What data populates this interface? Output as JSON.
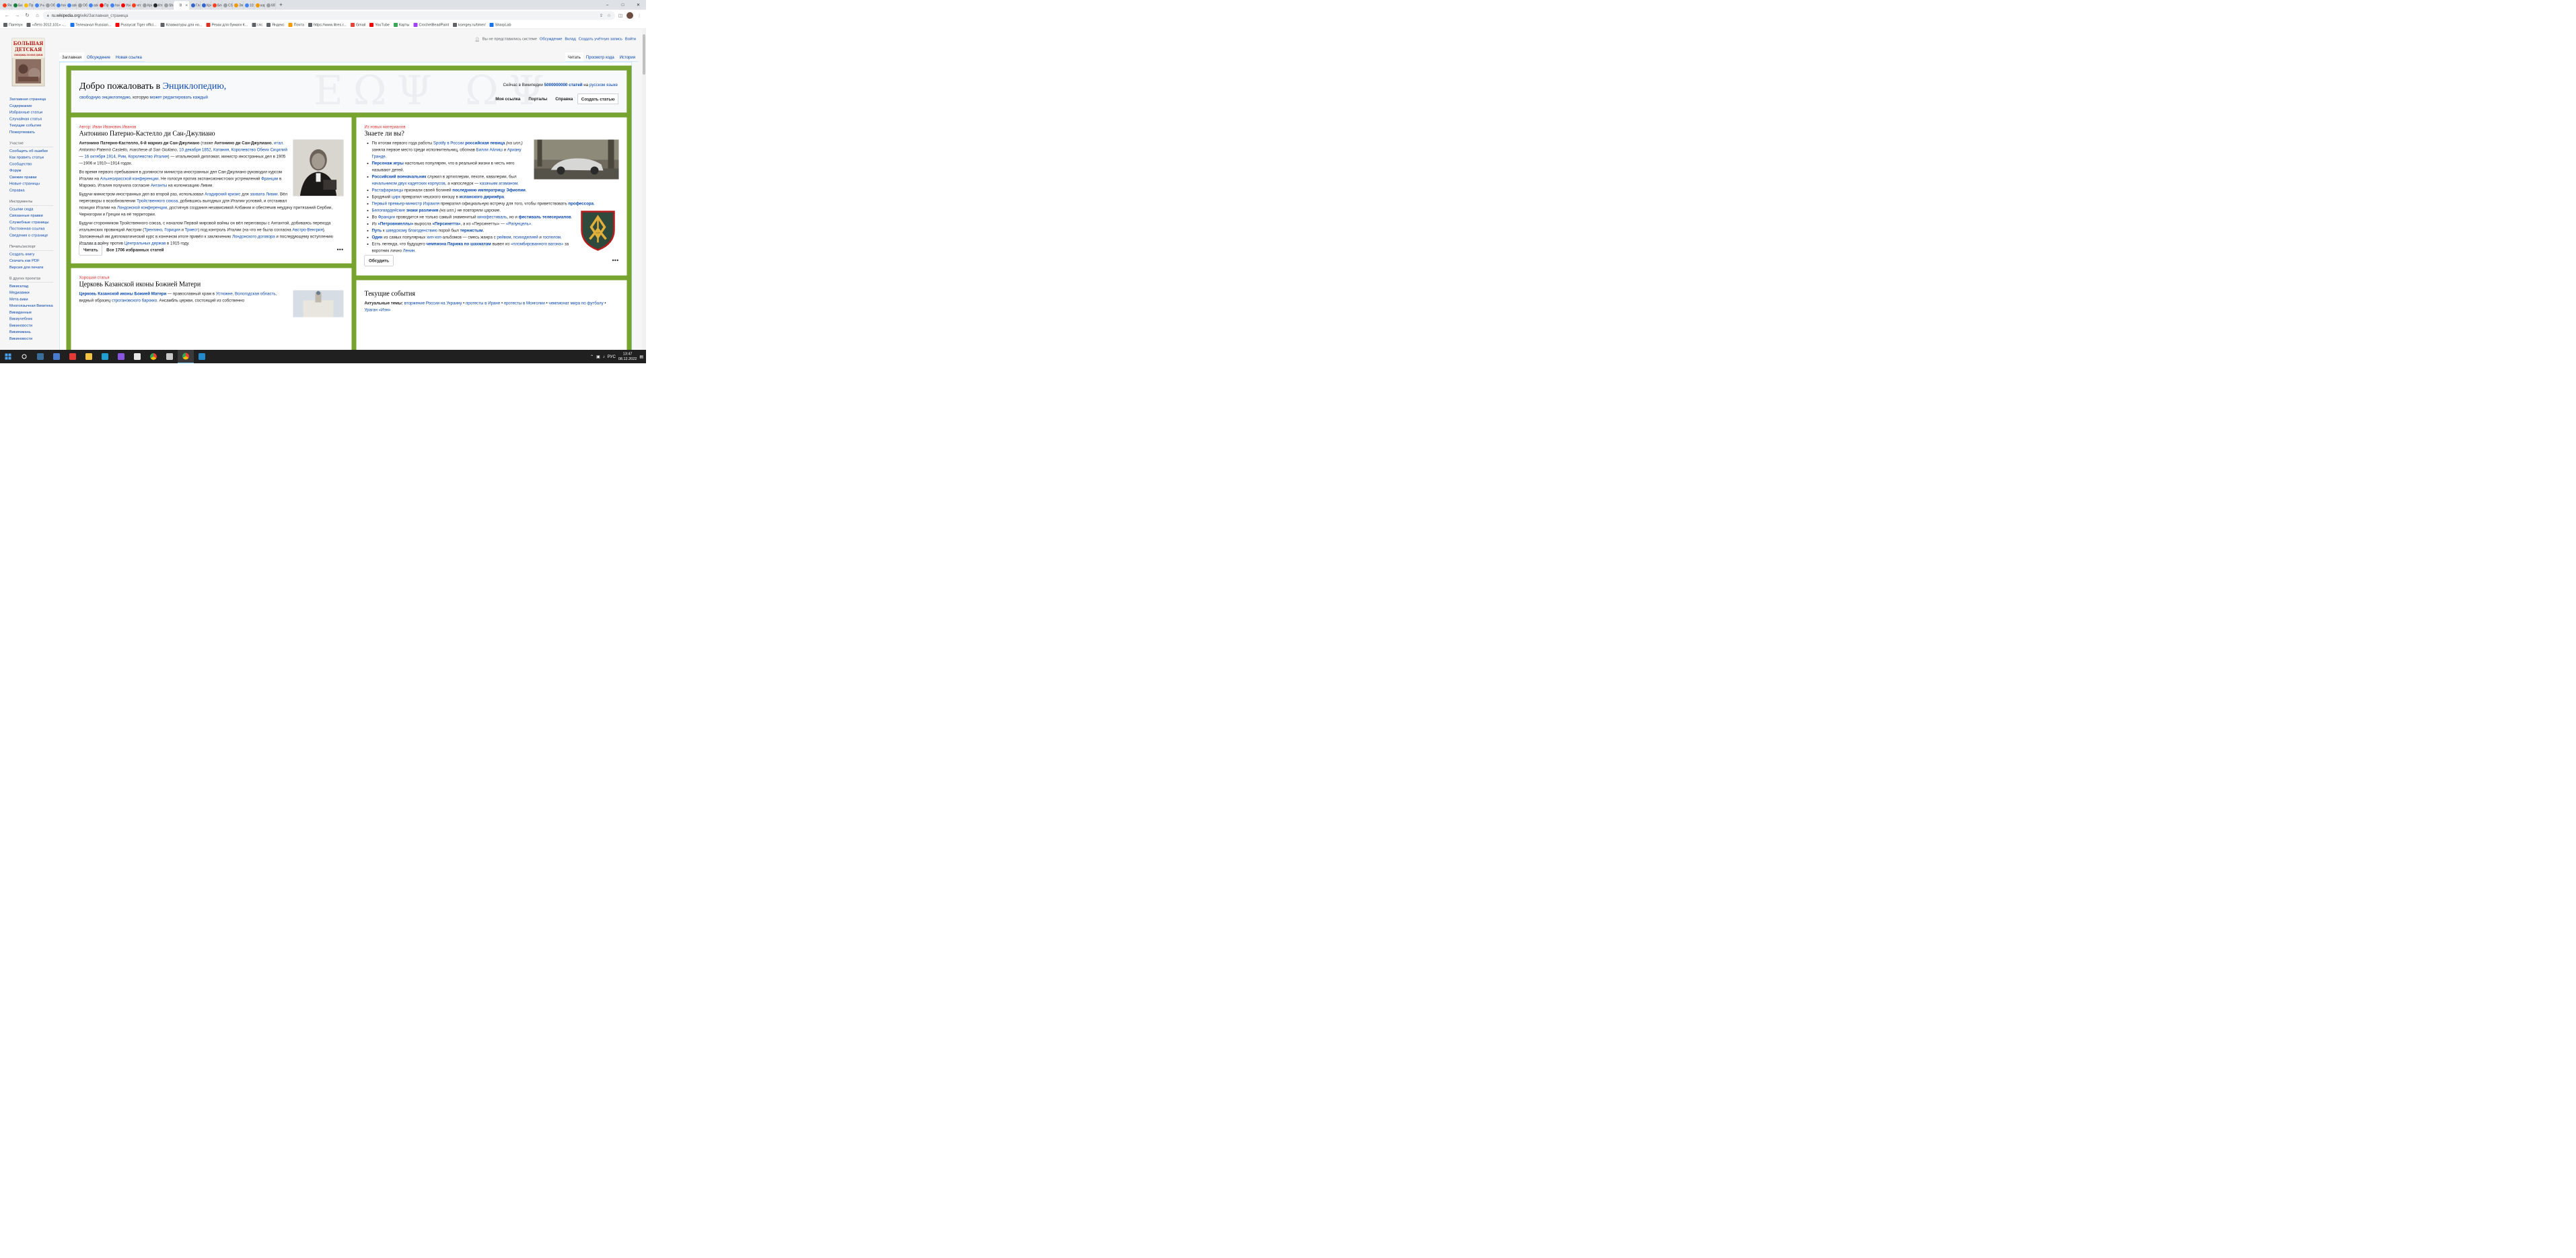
{
  "browser": {
    "tabs": [
      {
        "label": "Янд",
        "color": "#fc3f1d"
      },
      {
        "label": "Бин",
        "color": "#188038"
      },
      {
        "label": "Про",
        "color": "#fbbc04"
      },
      {
        "label": "Уча",
        "color": "#4285f4"
      },
      {
        "label": "Обу",
        "color": "#9aa0a6"
      },
      {
        "label": "hom",
        "color": "#4285f4"
      },
      {
        "label": "adc",
        "color": "#4285f4"
      },
      {
        "label": "Обу",
        "color": "#9aa0a6"
      },
      {
        "label": "adc",
        "color": "#4285f4"
      },
      {
        "label": "Про",
        "color": "#ff0000"
      },
      {
        "label": "hom",
        "color": "#4285f4"
      },
      {
        "label": "You",
        "color": "#ff0000"
      },
      {
        "label": "что",
        "color": "#fc3f1d"
      },
      {
        "label": "Кри",
        "color": "#9aa0a6"
      },
      {
        "label": "Кто",
        "color": "#24292f"
      },
      {
        "label": "Sho",
        "color": "#9aa0a6"
      },
      {
        "label": "В",
        "color": "#ffffff",
        "active": true
      },
      {
        "label": "Глав",
        "color": "#36c"
      },
      {
        "label": "Кре",
        "color": "#36c"
      },
      {
        "label": "Бес",
        "color": "#fc3f1d"
      },
      {
        "label": "СSS",
        "color": "#9aa0a6"
      },
      {
        "label": "Эну",
        "color": "#f29900"
      },
      {
        "label": "101",
        "color": "#4285f4"
      },
      {
        "label": "кар",
        "color": "#f29900"
      },
      {
        "label": "697",
        "color": "#9aa0a6"
      }
    ],
    "new_tab": "+",
    "url_host": "ru.wikipedia.org",
    "url_path": "/wiki/Заглавная_страница",
    "bookmarks": [
      {
        "label": "Пагепун",
        "color": "#5f6368"
      },
      {
        "label": "«Лето 2012.101» -...",
        "color": "#5f6368"
      },
      {
        "label": "Телеканал Russian...",
        "color": "#1a73e8"
      },
      {
        "label": "Pussycat Tiger offici...",
        "color": "#ff0000"
      },
      {
        "label": "Клавиатуры для но...",
        "color": "#5f6368"
      },
      {
        "label": "Резак для бумаги К...",
        "color": "#d93025"
      },
      {
        "label": "глс",
        "color": "#5f6368"
      },
      {
        "label": "Яндекс",
        "color": "#5f6368"
      },
      {
        "label": "Почта",
        "color": "#f29900"
      },
      {
        "label": "https://www.litres.r...",
        "color": "#5f6368"
      },
      {
        "label": "Gmail",
        "color": "#ea4335"
      },
      {
        "label": "YouTube",
        "color": "#ff0000"
      },
      {
        "label": "Карты",
        "color": "#34a853"
      },
      {
        "label": "CrochetBeadPaint",
        "color": "#a142f4"
      },
      {
        "label": "ksergey.ru/timer/",
        "color": "#5f6368"
      },
      {
        "label": "SharpLab",
        "color": "#1a73e8"
      }
    ]
  },
  "wiki": {
    "logo_lines": [
      "БОЛЬШАЯ",
      "ДЕТСКАЯ",
      "ЭНЦИКЛОПЕДИЯ"
    ],
    "personal": {
      "not_logged": "Вы не представились системе",
      "links": [
        "Обсуждение",
        "Вклад",
        "Создать учётную запись",
        "Войти"
      ]
    },
    "nav": [
      "Заглавная страница",
      "Содержание",
      "Избранные статьи",
      "Случайная статья",
      "Текущие события",
      "Пожертвовать"
    ],
    "sections": [
      {
        "title": "Участие",
        "items": [
          "Сообщить об ошибке",
          "Как править статьи",
          "Сообщество",
          "Форум",
          "Свежие правки",
          "Новые страницы",
          "Справка"
        ]
      },
      {
        "title": "Инструменты",
        "items": [
          "Ссылки сюда",
          "Связанные правки",
          "Служебные страницы",
          "Постоянная ссылка",
          "Сведения о странице"
        ]
      },
      {
        "title": "Печать/экспорт",
        "items": [
          "Создать книгу",
          "Скачать как PDF",
          "Версия для печати"
        ]
      },
      {
        "title": "В других проектах",
        "items": [
          "Викисклад",
          "Медиавики",
          "Мета-вики",
          "Многоязычная Викитека",
          "Викиданные",
          "Викиучебник",
          "Викиновости",
          "Викиязмань",
          "Викиновости"
        ]
      }
    ],
    "tabs_left": [
      "Заглавная",
      "Обсуждение",
      "Новая ссылка"
    ],
    "tabs_right": [
      "Читать",
      "Просмотр кода",
      "История"
    ],
    "welcome": {
      "title_prefix": "Добро пожаловать в ",
      "title_link": "Энциклопедию,",
      "sub_link1": "свободную энциклопедию",
      "sub_text": ", которую ",
      "sub_link2": "может редактировать каждый",
      "watermark": "ΕΩΨ ΩΨ",
      "stat_prefix": "Сейчас в Википедии ",
      "stat_count": "5000000000 статей",
      "stat_mid": " на ",
      "stat_lang": "русском языке",
      "buttons": [
        "Моя ссылка",
        "Порталы",
        "Справка",
        "Создать статью"
      ]
    },
    "featured": {
      "kicker": "Автор: Иван Иванович Иванов",
      "title": "Антонино Патерно-Кастелло ди Сан-Джулиано",
      "p1_bold": "Антонино Патерно-Кастелло, 6-й маркиз ди Сан-Джулиано",
      "p1_a": " (также ",
      "p1_bold2": "Антонино ди Сан-Джулиано",
      "p1_b": ", ",
      "p1_link1": "итал.",
      "p1_italic": " Antonino Paternò Castello, marchese di San Giuliano",
      "p1_c": ", ",
      "p1_link2": "10 декабря 1852",
      "p1_d": ", ",
      "p1_link3": "Катания",
      "p1_e": ", ",
      "p1_link4": "Королевство Обеих Сицилий",
      "p1_f": " — ",
      "p1_link5": "16 октября 1914",
      "p1_g": ", ",
      "p1_link6": "Рим",
      "p1_h": ", ",
      "p1_link7": "Королевство Италия",
      "p1_i": ") — итальянский дипломат, министр иностранных дел в 1905—1906 и 1910—1914 годах.",
      "p2_a": "Во время первого пребывания в должности министра иностранных дел Сан-Джулиано руководил курсом Италии на ",
      "p2_link1": "Альхесирасской конференции",
      "p2_b": ". Не голосуя против экспансионистских устремлений ",
      "p2_link2": "Франции",
      "p2_c": " в Марокко, Италия получила согласие ",
      "p2_link3": "Антанты",
      "p2_d": " на колонизацию Ливии.",
      "p3_a": "Будучи министром иностранных дел во второй раз, использовал ",
      "p3_link1": "Агадирский кризис",
      "p3_b": " для ",
      "p3_link2": "захвата Ливии",
      "p3_c": ". Вёл переговоры о возобновлении ",
      "p3_link3": "Тройственного союза",
      "p3_d": ", добившись выгодных для Италии условий, и отстаивал позиции Италии на ",
      "p3_link4": "Лондонской конференции",
      "p3_e": ", достигнув создания независимой Албании и обеспечив неудачу притязаний Сербии, Черногории и Греции на её территории.",
      "p4_a": "Будучи сторонником Тройственного союза, с началом Первой мировой войны он вёл переговоры с Антантой, добиваясь перехода итальянских провинций Австрии (",
      "p4_link1": "Трентино",
      "p4_b": ", ",
      "p4_link2": "Гориция",
      "p4_c": " и ",
      "p4_link3": "Триест",
      "p4_d": ") под контроль Италии (на что не была согласна ",
      "p4_link4": "Австро-Венгрия",
      "p4_e": "). Заложенный им дипломатический курс в конечном итоге привёл к заключению ",
      "p4_link5": "Лондонского договора",
      "p4_f": " и последующему вступлению Италии в войну против ",
      "p4_link6": "Центральных держав",
      "p4_g": " в 1915 году.",
      "read_btn": "Читать",
      "all_label": "Все 1706 избранных статей",
      "dots": "•••"
    },
    "good": {
      "kicker": "Хорошая статья",
      "title": "Церковь Казанской иконы Божией Матери",
      "p_bold": "Церковь Казанской иконы Божией Матери",
      "p_a": " — православный храм в ",
      "p_link1": "Устюжне",
      "p_b": ", ",
      "p_link2": "Вологодская область",
      "p_c": ", видный образец ",
      "p_link3": "строгановского барокко",
      "p_d": ". Ансамбль церкви, состоящий из собственно"
    },
    "dyk": {
      "kicker": "Из новых материалов",
      "title": "Знаете ли вы?",
      "items": [
        {
          "parts": [
            {
              "t": "По итогам первого года работы "
            },
            {
              "l": "Spotify в России"
            },
            {
              "t": " "
            },
            {
              "lb": "российская певица"
            },
            {
              "t": " "
            },
            {
              "i": "(на илл.)"
            },
            {
              "t": " заняла первое место среди исполнительниц, обогнав "
            },
            {
              "l": "Билли Айлиш"
            },
            {
              "t": " и "
            },
            {
              "l": "Ариану Гранде"
            },
            {
              "t": "."
            }
          ]
        },
        {
          "parts": [
            {
              "lb": "Персонаж игры"
            },
            {
              "t": " настолько популярен, что в реальной жизни в честь него называют детей."
            }
          ]
        },
        {
          "parts": [
            {
              "lb": "Российский военачальник"
            },
            {
              "t": " служил в артиллерии, пехоте, кавалерии, был "
            },
            {
              "l": "начальником двух кадетских корпусов"
            },
            {
              "t": ", а напоследок — "
            },
            {
              "l": "казачьим атаманом"
            },
            {
              "t": "."
            }
          ]
        },
        {
          "parts": [
            {
              "l": "Растафарианцы"
            },
            {
              "t": " признали своей богиней "
            },
            {
              "lb": "последнюю императрицу Эфиопии"
            },
            {
              "t": "."
            }
          ]
        },
        {
          "parts": [
            {
              "t": "Бродячий "
            },
            {
              "l": "цирк"
            },
            {
              "t": " превратил чешского юношу в "
            },
            {
              "lb": "испанского дирижёра"
            },
            {
              "t": "."
            }
          ]
        },
        {
          "parts": [
            {
              "l": "Первый премьер-министр Израиля"
            },
            {
              "t": " превратил официальную встречу для того, чтобы приветствовать "
            },
            {
              "lb": "профессора"
            },
            {
              "t": "."
            }
          ]
        },
        {
          "parts": [
            {
              "l": "Белогвардейские"
            },
            {
              "t": " "
            },
            {
              "lb": "знаки различия"
            },
            {
              "t": " "
            },
            {
              "i": "(на илл.)"
            },
            {
              "t": " не повторяли царские."
            }
          ]
        },
        {
          "parts": [
            {
              "t": "Во "
            },
            {
              "l": "Франции"
            },
            {
              "t": " проводится не только самый знаменитый "
            },
            {
              "l": "кинофестиваль"
            },
            {
              "t": ", но и "
            },
            {
              "lb": "фестиваль телесериалов"
            },
            {
              "t": "."
            }
          ]
        },
        {
          "parts": [
            {
              "t": "Из "
            },
            {
              "lb": "«Петровниеллы»"
            },
            {
              "t": " выросла "
            },
            {
              "lb": "«Персинетта»"
            },
            {
              "t": ", а из «Персинетты» — "
            },
            {
              "l": "«Рапунцель»"
            },
            {
              "t": "."
            }
          ]
        },
        {
          "parts": [
            {
              "lb": "Путь"
            },
            {
              "t": " к "
            },
            {
              "l": "шведскому благоденствию"
            },
            {
              "t": " порой был "
            },
            {
              "lb": "тернистым"
            },
            {
              "t": "."
            }
          ]
        },
        {
          "parts": [
            {
              "lb": "Один"
            },
            {
              "t": " из самых популярных "
            },
            {
              "l": "хип-хоп"
            },
            {
              "t": "-альбомов — смесь жанра с "
            },
            {
              "l": "рейвом"
            },
            {
              "t": ", "
            },
            {
              "l": "психоделией"
            },
            {
              "t": " и "
            },
            {
              "l": "госпелом"
            },
            {
              "t": "."
            }
          ]
        },
        {
          "parts": [
            {
              "t": "Есть легенда, что будущего "
            },
            {
              "lb": "чемпиона Парижа по шахматам"
            },
            {
              "t": " вывел из "
            },
            {
              "l": "«пломбированного вагона»"
            },
            {
              "t": " за воротник лично "
            },
            {
              "l": "Ленин"
            },
            {
              "t": "."
            }
          ]
        }
      ],
      "discuss_btn": "Обсудить",
      "dots": "•••"
    },
    "current": {
      "title": "Текущие события",
      "label": "Актуальные темы:",
      "topics": [
        "вторжение России на Украину",
        "протесты в Иране",
        "протесты в Монголии",
        "чемпионат мира по футболу",
        "Ураган «Иэн»"
      ]
    }
  },
  "taskbar": {
    "icons": [
      {
        "name": "start-icon",
        "color": "#4aa3ef"
      },
      {
        "name": "search-icon",
        "color": "#ffffff"
      },
      {
        "name": "calculator-icon",
        "color": "#3a6d9a"
      },
      {
        "name": "store-icon",
        "color": "#4a7cd0"
      },
      {
        "name": "antivirus-icon",
        "color": "#e53935"
      },
      {
        "name": "explorer-icon",
        "color": "#f5c242"
      },
      {
        "name": "edge-icon",
        "color": "#1fa0d0"
      },
      {
        "name": "messenger-icon",
        "color": "#8a55e0"
      },
      {
        "name": "yandex-browser-icon",
        "color": "#e8e8e8"
      },
      {
        "name": "chrome-icon",
        "color": "#4caf50"
      },
      {
        "name": "steam-icon",
        "color": "#c8c8c8"
      },
      {
        "name": "chrome-active-icon",
        "color": "#4caf50"
      },
      {
        "name": "vscode-icon",
        "color": "#2489ca"
      }
    ],
    "lang": "РУС",
    "time": "13:47",
    "date": "08.12.2022"
  }
}
